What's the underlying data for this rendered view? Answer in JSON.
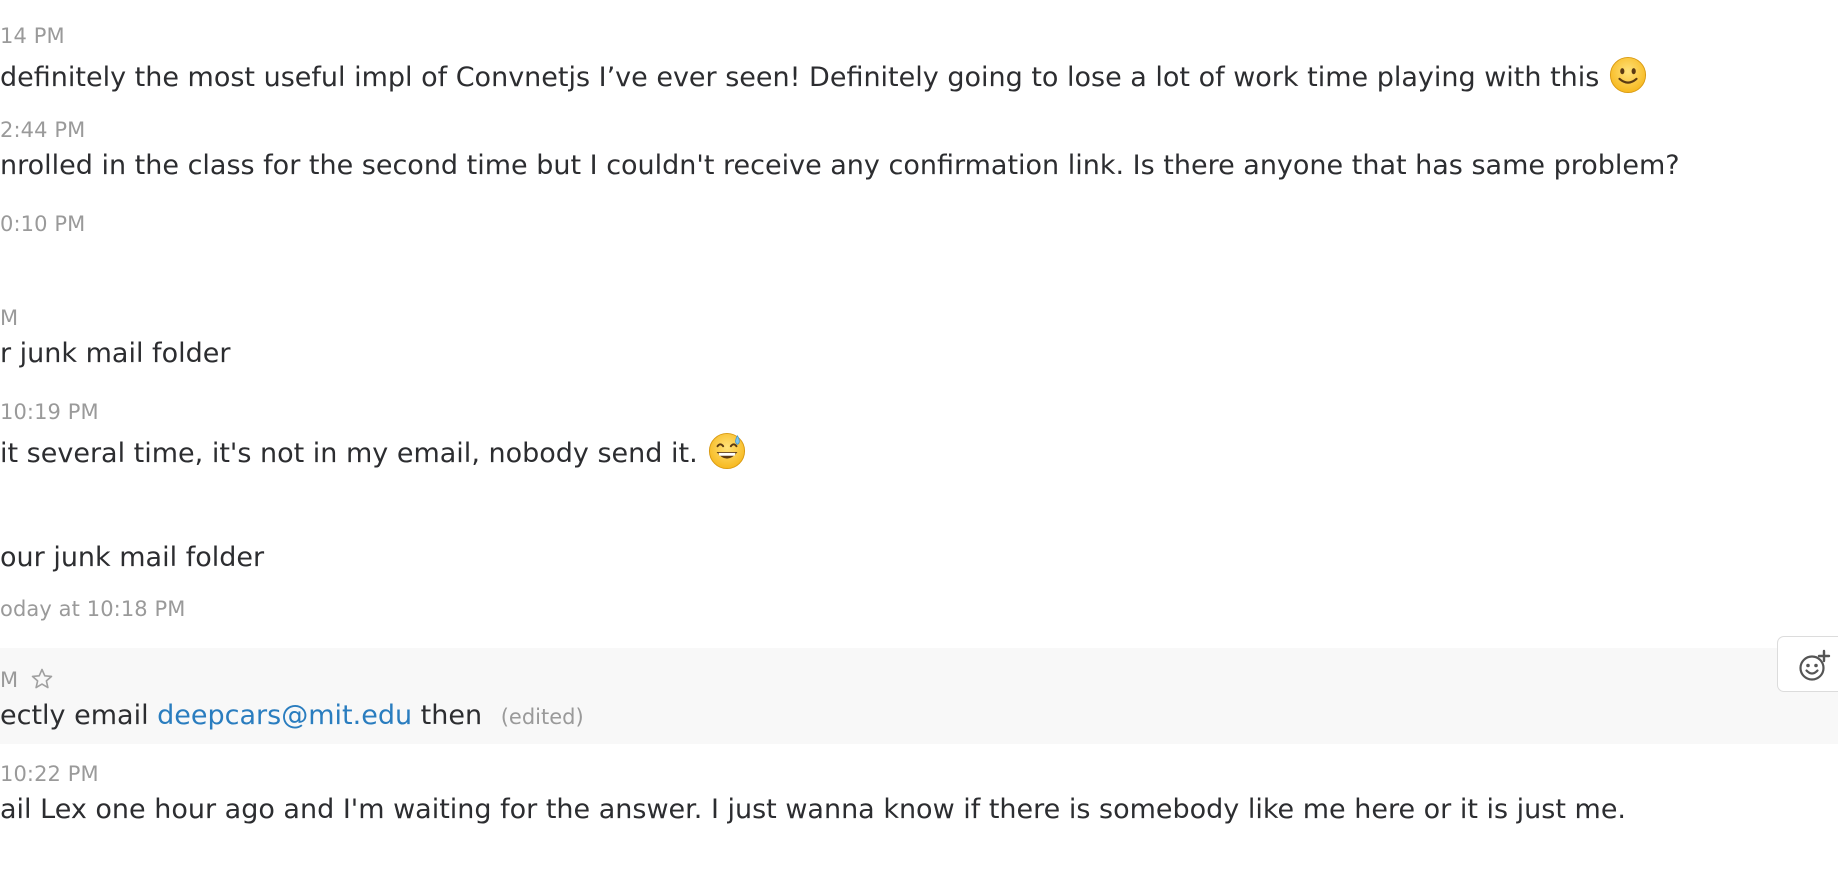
{
  "messages": [
    {
      "timestamp": "14 PM",
      "text": " definitely the most useful impl of Convnetjs I’ve ever seen! Definitely going to lose a lot of work time playing with this",
      "emoji": "slightly-smiling-face"
    },
    {
      "timestamp": "2:44 PM",
      "text": "nrolled in the class for the second time but I couldn't receive any confirmation link. Is there anyone that has same problem?"
    },
    {
      "timestamp": "0:10 PM"
    },
    {
      "timestamp": "M",
      "text": "r junk mail folder"
    },
    {
      "timestamp": "10:19 PM",
      "text": " it several time, it's not in my email, nobody send it.",
      "emoji": "grinning-sweat-face"
    },
    {
      "text": "our junk mail folder",
      "timestamp": "oday at 10:18 PM"
    },
    {
      "timestamp": "M",
      "text_before": "ectly email",
      "link": "deepcars@mit.edu",
      "text_after": "then",
      "edited": "(edited)"
    },
    {
      "timestamp": "10:22 PM",
      "text": "ail Lex one hour ago and I'm waiting for the answer. I just wanna know if there is somebody like me here or it is just me."
    }
  ],
  "colors": {
    "timestamp": "#9a9a9a",
    "text": "#2c2d30",
    "link": "#2a7dbf",
    "hover_background": "#f8f8f8"
  },
  "icons": {
    "star": "star-icon",
    "add_reaction": "add-reaction-icon"
  }
}
